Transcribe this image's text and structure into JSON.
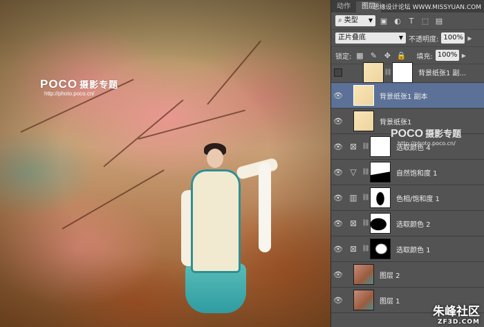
{
  "canvas": {
    "watermark_logo": "POCO",
    "watermark_logo_zh": "摄影专题",
    "watermark_url": "http://photo.poco.cn/"
  },
  "panel": {
    "tabs": [
      "动作",
      "图层"
    ],
    "tab_watermark": "思缘设计论坛 WWW.MISSYUAN.COM",
    "filter": {
      "icon": "search-icon",
      "label": "类型"
    },
    "blend_mode": "正片叠底",
    "opacity_label": "不透明度:",
    "opacity_value": "100%",
    "lock_label": "锁定:",
    "fill_label": "填充:",
    "fill_value": "100%",
    "watermark_logo": "POCO",
    "watermark_logo_zh": "摄影专题",
    "watermark_url": "http://photo.poco.cn/",
    "layers": [
      {
        "name": "背景纸张1 副...",
        "visible": false,
        "thumb": "paper",
        "mask": "white",
        "selected": false
      },
      {
        "name": "背景纸张1 副本",
        "visible": true,
        "thumb": "paper",
        "mask": null,
        "selected": true
      },
      {
        "name": "背景纸张1",
        "visible": true,
        "thumb": "paper",
        "mask": null,
        "selected": false
      },
      {
        "name": "选取颜色 4",
        "visible": true,
        "adj_icon": "selective-color-icon",
        "mask": "white",
        "selected": false
      },
      {
        "name": "自然饱和度 1",
        "visible": true,
        "adj_icon": "vibrance-icon",
        "mask": "hills",
        "selected": false
      },
      {
        "name": "色相/饱和度 1",
        "visible": true,
        "adj_icon": "hue-saturation-icon",
        "mask": "figure",
        "selected": false
      },
      {
        "name": "选取颜色 2",
        "visible": true,
        "adj_icon": "selective-color-icon",
        "mask": "figure",
        "selected": false
      },
      {
        "name": "选取颜色 1",
        "visible": true,
        "adj_icon": "selective-color-icon",
        "mask": "dark",
        "selected": false
      },
      {
        "name": "图层 2",
        "visible": true,
        "thumb": "photo",
        "mask": null,
        "selected": false
      },
      {
        "name": "图层 1",
        "visible": true,
        "thumb": "photo",
        "mask": null,
        "selected": false
      }
    ]
  },
  "brand": {
    "name": "朱峰社区",
    "url": "ZF3D.COM"
  }
}
